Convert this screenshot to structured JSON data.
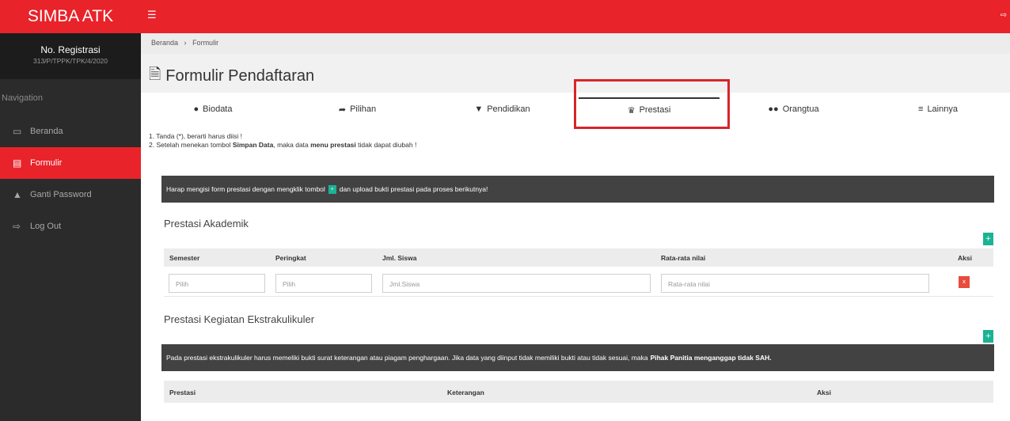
{
  "brand": "SIMBA ATK",
  "registration": {
    "label": "No. Registrasi",
    "value": "313/P/TPPK/TPK/4/2020"
  },
  "nav": {
    "heading": "Navigation",
    "items": [
      {
        "label": "Beranda",
        "icon": "monitor-icon",
        "active": false
      },
      {
        "label": "Formulir",
        "icon": "document-icon",
        "active": true
      },
      {
        "label": "Ganti Password",
        "icon": "lock-icon",
        "active": false
      },
      {
        "label": "Log Out",
        "icon": "logout-icon",
        "active": false
      }
    ]
  },
  "breadcrumb": {
    "home": "Beranda",
    "separator": "›",
    "current": "Formulir"
  },
  "page_title": "Formulir Pendaftaran",
  "tabs": [
    {
      "label": "Biodata",
      "icon": "user-icon"
    },
    {
      "label": "Pilihan",
      "icon": "share-icon"
    },
    {
      "label": "Pendidikan",
      "icon": "graduation-cap-icon"
    },
    {
      "label": "Prestasi",
      "icon": "trophy-icon",
      "active": true
    },
    {
      "label": "Orangtua",
      "icon": "users-icon"
    },
    {
      "label": "Lainnya",
      "icon": "bars-icon"
    }
  ],
  "notes": {
    "line1": "1. Tanda (*), berarti harus diisi !",
    "line2_pre": "2. Setelah menekan tombol ",
    "line2_b1": "Simpan Data",
    "line2_mid": ", maka data ",
    "line2_b2": "menu prestasi",
    "line2_post": " tidak dapat diubah !"
  },
  "alert1": {
    "pre": "Harap mengisi form prestasi dengan mengklik tombol",
    "btn": "+",
    "post": "dan upload bukti prestasi pada proses berikutnya!"
  },
  "akademik": {
    "title": "Prestasi Akademik",
    "add": "+",
    "headers": {
      "semester": "Semester",
      "peringkat": "Peringkat",
      "jml": "Jml. Siswa",
      "rata": "Rata-rata nilai",
      "aksi": "Aksi"
    },
    "row": {
      "semester": "Pilih",
      "peringkat": "Pilih",
      "jml_placeholder": "Jml.Siswa",
      "rata_placeholder": "Rata-rata nilai",
      "delete": "x"
    }
  },
  "ekstra": {
    "title": "Prestasi Kegiatan Ekstrakulikuler",
    "add": "+",
    "alert_pre": "Pada prestasi ekstrakulikuler harus memeliki bukti surat keterangan atau piagam penghargaan. Jika data yang diinput tidak memiliki bukti atau tidak sesuai, maka",
    "alert_bold": "Pihak Panitia menganggap tidak SAH.",
    "headers": {
      "prestasi": "Prestasi",
      "keterangan": "Keterangan",
      "aksi": "Aksi"
    }
  },
  "colors": {
    "brand_red": "#e8232a",
    "sidebar_dark": "#2b2b2b",
    "accent_green": "#1ab394",
    "alert_dark": "#424242",
    "highlight_red": "#d8252b"
  }
}
